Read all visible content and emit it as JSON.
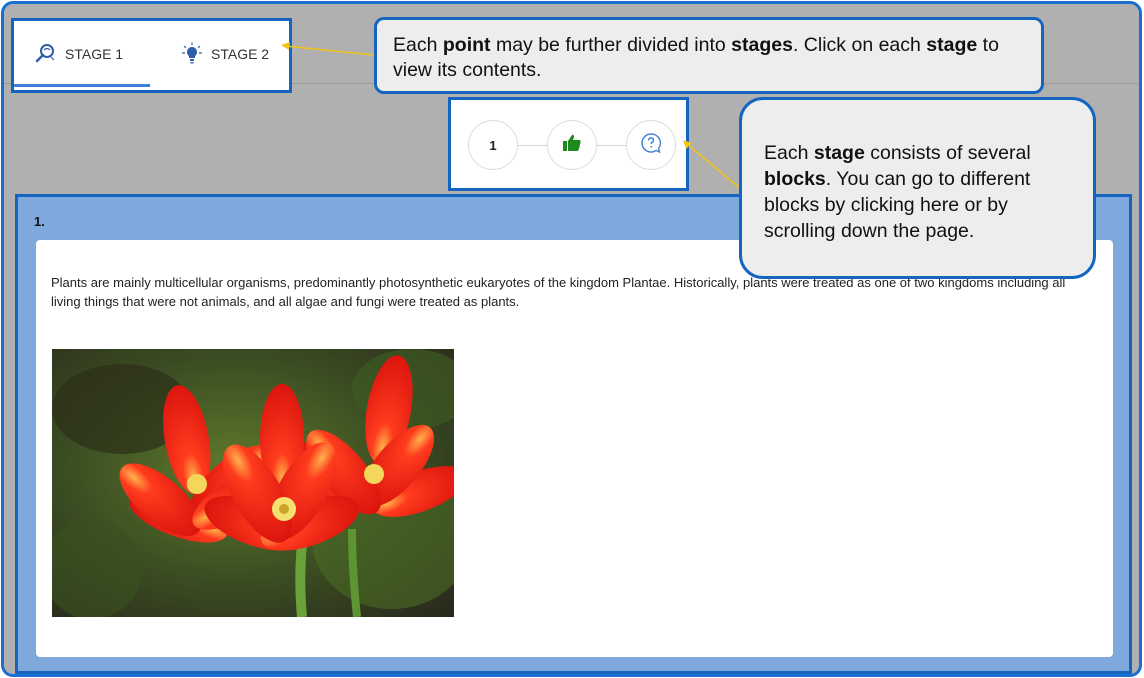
{
  "tabs": [
    {
      "label": "STAGE 1",
      "icon": "magnifier-icon",
      "active": true
    },
    {
      "label": "STAGE 2",
      "icon": "lightbulb-icon",
      "active": false
    }
  ],
  "block_nav": {
    "steps": [
      {
        "label": "1"
      },
      {
        "icon": "thumbs-up-icon"
      },
      {
        "icon": "question-bubble-icon"
      }
    ]
  },
  "callouts": {
    "stages": {
      "t1": "Each ",
      "b1": "point",
      "t2": " may be further divided into ",
      "b2": "stages",
      "t3": ". Click on each ",
      "b3": "stage",
      "t4": " to view its contents."
    },
    "blocks": {
      "t1": "Each ",
      "b1": "stage",
      "t2": " consists of several ",
      "b2": "blocks",
      "t3": ". You can go to different blocks by clicking here or by scrolling down the page."
    }
  },
  "block": {
    "number": "1.",
    "text": "Plants are mainly multicellular organisms, predominantly photosynthetic eukaryotes of the kingdom Plantae. Historically, plants were treated as one of two kingdoms including all living things that were not animals, and all algae and fungi were treated as plants."
  },
  "colors": {
    "accent": "#1565c0",
    "panel": "#7fa8dc",
    "thumbs_up": "#1e8a1e",
    "question": "#3f7fd6"
  }
}
